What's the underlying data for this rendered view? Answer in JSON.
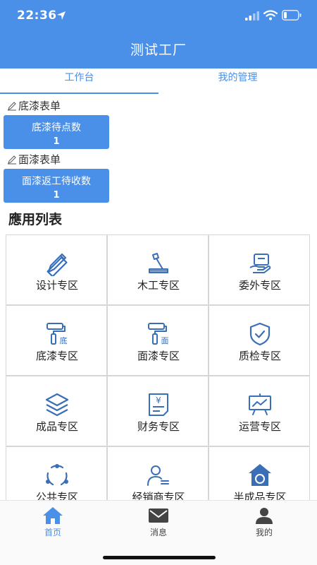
{
  "status": {
    "time": "22:36"
  },
  "header": {
    "title": "测试工厂"
  },
  "tabs": [
    {
      "label": "工作台"
    },
    {
      "label": "我的管理"
    }
  ],
  "sections": [
    {
      "label": "底漆表单",
      "button": {
        "label": "底漆待点数",
        "value": "1"
      }
    },
    {
      "label": "面漆表单",
      "button": {
        "label": "面漆返工待收数",
        "value": "1"
      }
    }
  ],
  "apps": {
    "title": "應用列表",
    "items": [
      {
        "label": "设计专区",
        "icon": "design-icon"
      },
      {
        "label": "木工专区",
        "icon": "woodwork-icon"
      },
      {
        "label": "委外专区",
        "icon": "outsource-icon"
      },
      {
        "label": "底漆专区",
        "icon": "primer-roller-icon"
      },
      {
        "label": "面漆专区",
        "icon": "topcoat-roller-icon"
      },
      {
        "label": "质检专区",
        "icon": "shield-check-icon"
      },
      {
        "label": "成品专区",
        "icon": "layers-icon"
      },
      {
        "label": "财务专区",
        "icon": "finance-icon"
      },
      {
        "label": "运营专区",
        "icon": "operations-board-icon"
      },
      {
        "label": "公共专区",
        "icon": "share-circle-icon"
      },
      {
        "label": "经销商专区",
        "icon": "dealer-icon"
      },
      {
        "label": "半成品专区",
        "icon": "house-refresh-icon"
      }
    ]
  },
  "primer_badge": "底",
  "topcoat_badge": "面",
  "finance_symbol": "¥",
  "bottom_nav": [
    {
      "label": "首页",
      "icon": "home-icon"
    },
    {
      "label": "消息",
      "icon": "mail-icon"
    },
    {
      "label": "我的",
      "icon": "user-icon"
    }
  ],
  "colors": {
    "primary": "#4a8fe8",
    "icon_dark": "#3a6fb8"
  }
}
